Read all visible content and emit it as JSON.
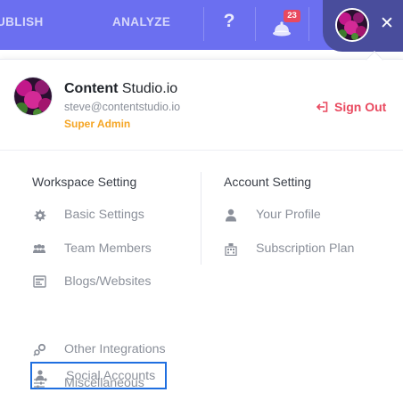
{
  "topbar": {
    "nav_publish": "UBLISH",
    "nav_analyze": "ANALYZE",
    "help_label": "?",
    "notification_count": "23"
  },
  "profile": {
    "name_bold": "Content",
    "name_rest": " Studio.io",
    "email": "steve@contentstudio.io",
    "role": "Super Admin",
    "sign_out": "Sign Out"
  },
  "workspace": {
    "title": "Workspace Setting",
    "items": [
      {
        "label": "Basic Settings",
        "icon": "gear-icon"
      },
      {
        "label": "Team Members",
        "icon": "team-icon"
      },
      {
        "label": "Blogs/Websites",
        "icon": "blog-icon"
      },
      {
        "label": "Social Accounts",
        "icon": "social-accounts-icon"
      },
      {
        "label": "Other Integrations",
        "icon": "integrations-icon"
      },
      {
        "label": "Miscellaneous",
        "icon": "sliders-icon"
      }
    ]
  },
  "account": {
    "title": "Account Setting",
    "items": [
      {
        "label": "Your Profile",
        "icon": "user-icon"
      },
      {
        "label": "Subscription Plan",
        "icon": "subscription-icon"
      }
    ]
  },
  "colors": {
    "topbar": "#6b6ff0",
    "pill": "#494d9c",
    "accent_red": "#e9495f",
    "role_orange": "#f5a524",
    "highlight_blue": "#1f6fe0",
    "menu_text": "#8b909a"
  }
}
